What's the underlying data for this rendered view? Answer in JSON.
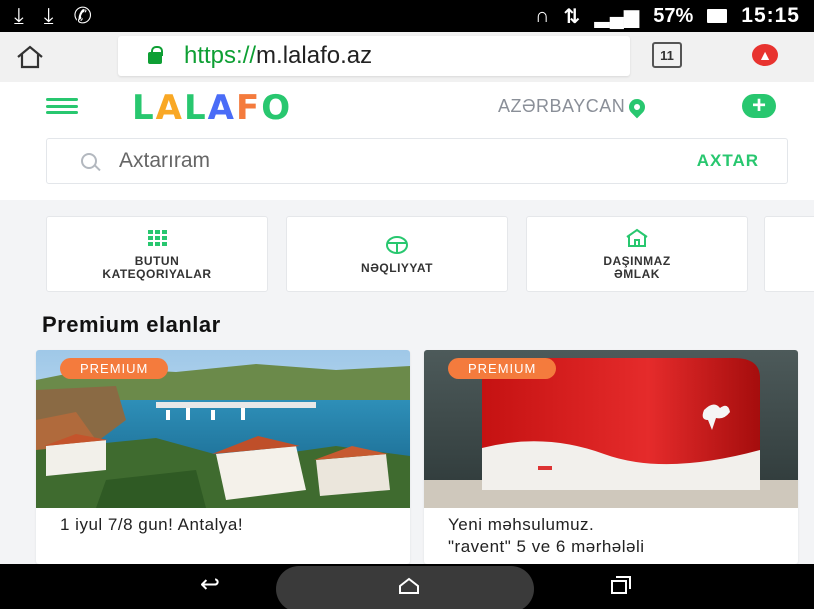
{
  "status_bar": {
    "left_icons": [
      "download-done-icon",
      "download-done-icon",
      "whatsapp-icon"
    ],
    "right_icons": [
      "headphones-icon",
      "data-transfer-icon",
      "signal-icon"
    ],
    "battery": "57%",
    "time": "15:15"
  },
  "browser": {
    "url_scheme": "https://",
    "url_host": "m.lalafo.az",
    "tabs_count": "11"
  },
  "site": {
    "logo_letters": [
      "L",
      "A",
      "L",
      "A",
      "F",
      "O"
    ],
    "logo_colors": [
      "#28c76f",
      "#f9a825",
      "#28c76f",
      "#4a6cf7",
      "#f47b3d",
      "#28c76f"
    ],
    "region": "AZƏRBAYCAN",
    "search_placeholder": "Axtarıram",
    "search_button": "AXTAR"
  },
  "categories": [
    {
      "label": "BUTUN\nKATEQORIYALAR",
      "icon": "grid-icon"
    },
    {
      "label": "NƏQLIYYAT",
      "icon": "steering-wheel-icon"
    },
    {
      "label": "DAŞINMAZ\nƏMLAK",
      "icon": "house-icon"
    }
  ],
  "section_title": "Premium elanlar",
  "listings": [
    {
      "badge": "PREMIUM",
      "title": "1 iyul 7/8 gun! Antalya!"
    },
    {
      "badge": "PREMIUM",
      "title": "Yeni məhsulumuz.\n\"ravent\" 5 ve 6 mərhələli"
    }
  ],
  "accent_color": "#28c76f",
  "badge_color": "#f47b3d"
}
